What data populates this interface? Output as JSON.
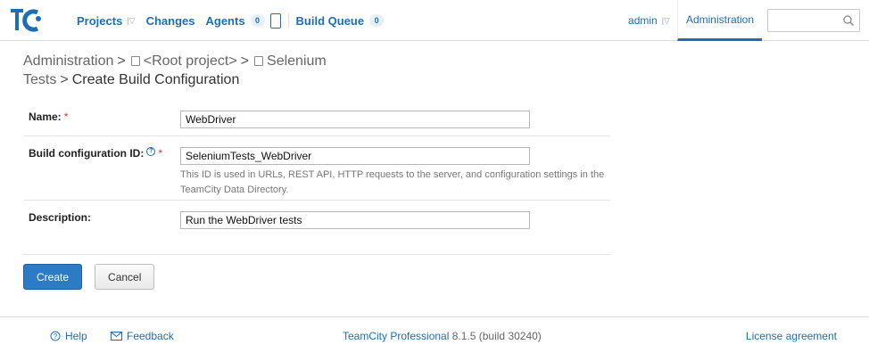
{
  "header": {
    "nav": [
      {
        "label": "Projects",
        "has_caret": true
      },
      {
        "label": "Changes"
      },
      {
        "label": "Agents",
        "count": "0"
      },
      {
        "label": "Build Queue",
        "count": "0"
      }
    ],
    "user": "admin",
    "admin_tab": "Administration",
    "search": {
      "value": "",
      "placeholder": ""
    }
  },
  "breadcrumb": {
    "items": [
      "Administration",
      "<Root project>",
      "Selenium Tests"
    ],
    "current": "Create Build Configuration"
  },
  "form": {
    "name": {
      "label": "Name:",
      "required_mark": "*",
      "value": "WebDriver"
    },
    "build_config_id": {
      "label": "Build configuration ID:",
      "help_mark": "?",
      "required_mark": "*",
      "value": "SeleniumTests_WebDriver",
      "note": "This ID is used in URLs, REST API, HTTP requests to the server, and configuration settings in the TeamCity Data Directory."
    },
    "description": {
      "label": "Description:",
      "value": "Run the WebDriver tests"
    }
  },
  "buttons": {
    "create": "Create",
    "cancel": "Cancel"
  },
  "footer": {
    "help": "Help",
    "feedback": "Feedback",
    "product": "TeamCity Professional",
    "version": "8.1.5 (build 30240)",
    "license": "License agreement"
  },
  "colors": {
    "link": "#1c6fb6",
    "primary_button": "#2d7bc4",
    "required": "#dd3333"
  }
}
